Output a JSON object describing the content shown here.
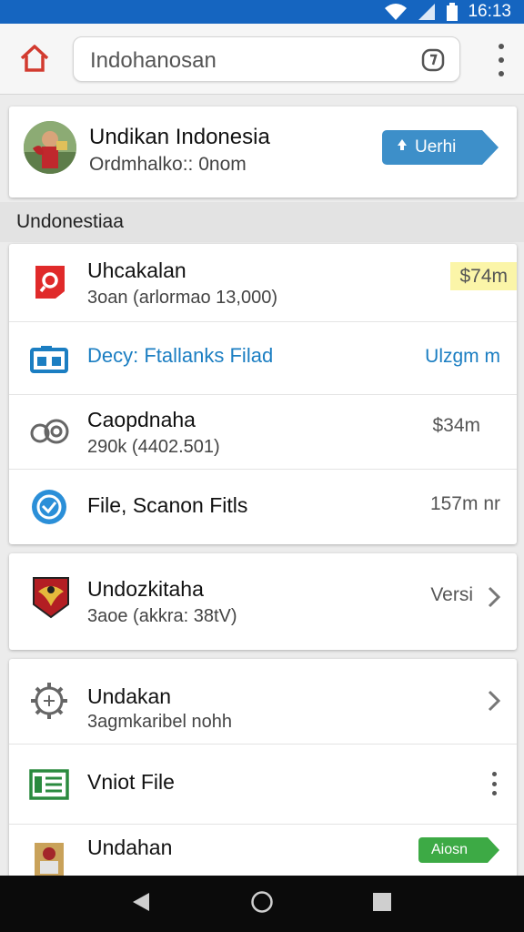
{
  "status_bar": {
    "time": "16:13",
    "bg_color": "#1565c0"
  },
  "toolbar": {
    "home_icon": "home-icon",
    "url_text": "Indohanosan",
    "shield_icon": "shield-icon",
    "menu_icon": "overflow-menu-icon"
  },
  "profile": {
    "title": "Undikan Indonesia",
    "subtitle": "Ordmhalko:: 0nom",
    "button_label": "Uerhi",
    "button_color": "#3d8fc9"
  },
  "section": {
    "title": "Undonestiaa"
  },
  "files": [
    {
      "icon": "red-app-icon",
      "title": "Uhcakalan",
      "subtitle": "3oan (arlormao 13,000)",
      "value": "$74m"
    },
    {
      "icon": "camera-icon",
      "title": "Decy: Ftallanks Filad",
      "subtitle": "",
      "value": "Ulzgm m"
    },
    {
      "icon": "camera-lens-icon",
      "title": "Caopdnaha",
      "subtitle": "290k (4402.501)",
      "value": "$34m"
    },
    {
      "icon": "blue-circle-icon",
      "title": "File, Scanon Fitls",
      "subtitle": "",
      "value": "157m nr"
    }
  ],
  "single": {
    "icon": "emblem-icon",
    "title": "Undozkitaha",
    "subtitle": "3aoe (akkra: 38tV)",
    "value": "Versi"
  },
  "settings": [
    {
      "icon": "gear-icon",
      "title": "Undakan",
      "subtitle": "3agmkaribel nohh"
    },
    {
      "icon": "document-icon",
      "title": "Vniot File",
      "subtitle": ""
    },
    {
      "icon": "emblem-icon",
      "title": "Undahan",
      "subtitle": "",
      "button_label": "Aiosn"
    }
  ],
  "nav": {
    "back_icon": "back-icon",
    "home_icon": "home-circle-icon",
    "recents_icon": "recents-icon"
  }
}
